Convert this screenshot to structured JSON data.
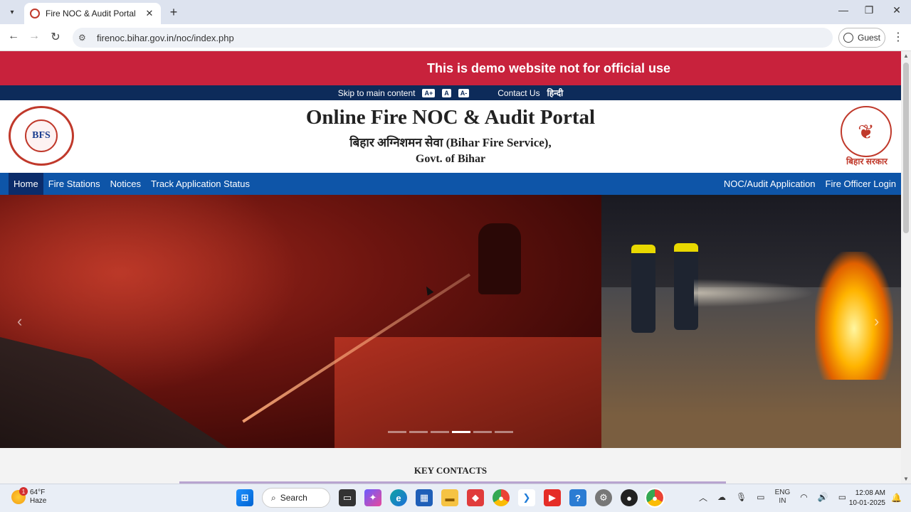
{
  "browser": {
    "tab_title": "Fire NOC & Audit Portal",
    "tab_close": "✕",
    "new_tab": "+",
    "url": "firenoc.bihar.gov.in/noc/index.php",
    "profile_label": "Guest",
    "minimize": "—",
    "restore": "❐",
    "close": "✕",
    "back": "←",
    "forward": "→",
    "reload": "↻",
    "menu": "⋮",
    "tab_list": "▾"
  },
  "banner": {
    "demo_text": "This is demo website not for official use"
  },
  "accessibility": {
    "skip_link": "Skip to main content",
    "font_increase": "A+",
    "font_normal": "A",
    "font_decrease": "A-",
    "contact": "Contact Us",
    "language": "हिन्दी"
  },
  "header": {
    "title": "Online Fire NOC & Audit Portal",
    "subtitle": "बिहार अग्निशमन सेवा (Bihar Fire Service),",
    "govt": "Govt. of Bihar",
    "left_logo_text": "BFS",
    "right_logo_text": "बिहार सरकार"
  },
  "nav": {
    "left_items": [
      "Home",
      "Fire Stations",
      "Notices",
      "Track Application Status"
    ],
    "right_items": [
      "NOC/Audit Application",
      "Fire Officer Login"
    ],
    "active_index": 0
  },
  "carousel": {
    "prev": "‹",
    "next": "›",
    "indicator_count": 6,
    "active_indicator": 3
  },
  "section": {
    "key_contacts": "KEY CONTACTS"
  },
  "taskbar": {
    "weather_temp": "64°F",
    "weather_desc": "Haze",
    "weather_badge": "1",
    "search_label": "Search",
    "lang_line1": "ENG",
    "lang_line2": "IN",
    "time": "12:08 AM",
    "date": "10-01-2025"
  }
}
